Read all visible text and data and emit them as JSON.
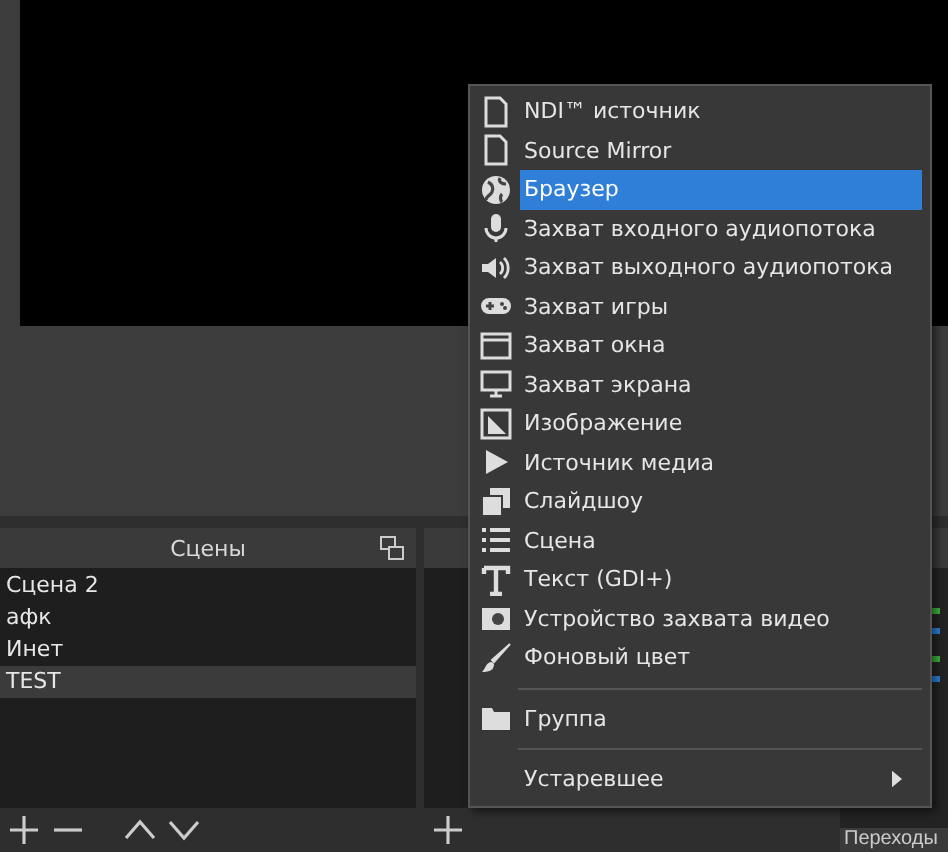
{
  "scenes": {
    "title": "Сцены",
    "items": [
      {
        "label": "Сцена 2",
        "selected": false
      },
      {
        "label": "афк",
        "selected": false
      },
      {
        "label": "Инет",
        "selected": false
      },
      {
        "label": "TEST",
        "selected": true
      }
    ]
  },
  "transitions": {
    "title": "Переходы"
  },
  "add_source_menu": {
    "items": [
      {
        "kind": "item",
        "label": "NDI™ источник",
        "selected": false
      },
      {
        "kind": "item",
        "label": "Source Mirror",
        "selected": false
      },
      {
        "kind": "item",
        "label": "Браузер",
        "selected": true
      },
      {
        "kind": "item",
        "label": "Захват входного аудиопотока",
        "selected": false
      },
      {
        "kind": "item",
        "label": "Захват выходного аудиопотока",
        "selected": false
      },
      {
        "kind": "item",
        "label": "Захват игры",
        "selected": false
      },
      {
        "kind": "item",
        "label": "Захват окна",
        "selected": false
      },
      {
        "kind": "item",
        "label": "Захват экрана",
        "selected": false
      },
      {
        "kind": "item",
        "label": "Изображение",
        "selected": false
      },
      {
        "kind": "item",
        "label": "Источник медиа",
        "selected": false
      },
      {
        "kind": "item",
        "label": "Слайдшоу",
        "selected": false
      },
      {
        "kind": "item",
        "label": "Сцена",
        "selected": false
      },
      {
        "kind": "item",
        "label": "Текст (GDI+)",
        "selected": false
      },
      {
        "kind": "item",
        "label": "Устройство захвата видео",
        "selected": false
      },
      {
        "kind": "item",
        "label": "Фоновый цвет",
        "selected": false
      },
      {
        "kind": "separator"
      },
      {
        "kind": "item",
        "label": "Группа",
        "selected": false
      },
      {
        "kind": "separator"
      },
      {
        "kind": "submenu",
        "label": "Устаревшее",
        "selected": false
      }
    ]
  }
}
